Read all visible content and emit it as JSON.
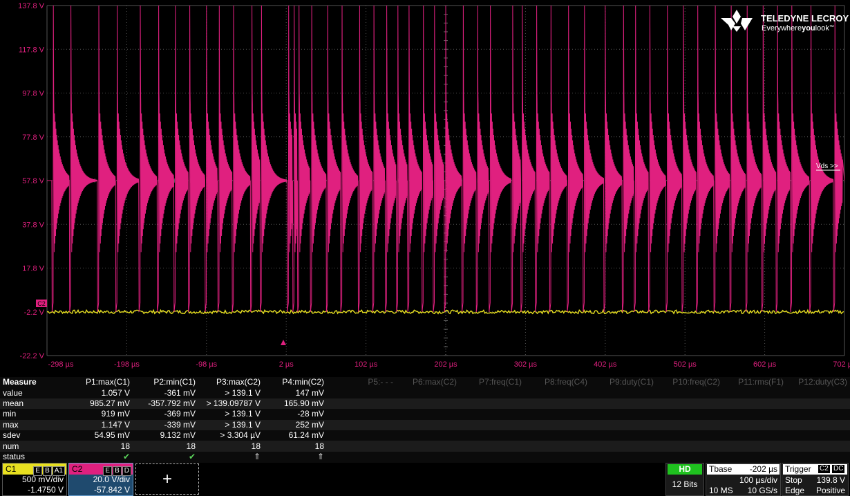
{
  "brand": {
    "name": "TELEDYNE LECROY",
    "tagline_parts": [
      "Everywhere",
      "you",
      "look"
    ],
    "trademark": "™"
  },
  "colors": {
    "c1": "#e8e020",
    "c2": "#e0207f",
    "grid": "#555555",
    "measure_ok": "#5cd65c"
  },
  "y_axis_labels": [
    "137.8 V",
    "117.8 V",
    "97.8 V",
    "77.8 V",
    "57.8 V",
    "37.8 V",
    "17.8 V",
    "-2.2 V",
    "-22.2 V"
  ],
  "x_axis_labels": [
    "-298 µs",
    "-198 µs",
    "-98 µs",
    "2 µs",
    "102 µs",
    "202 µs",
    "302 µs",
    "402 µs",
    "502 µs",
    "602 µs",
    "702 µs"
  ],
  "trace_label": "Vds >>",
  "channel_marker": "C2",
  "measure": {
    "title": "Measure",
    "params": [
      {
        "label": "P1:max(C1)",
        "active": true
      },
      {
        "label": "P2:min(C1)",
        "active": true
      },
      {
        "label": "P3:max(C2)",
        "active": true
      },
      {
        "label": "P4:min(C2)",
        "active": true
      },
      {
        "label": "P5:- - -",
        "active": false
      },
      {
        "label": "P6:max(C2)",
        "active": false
      },
      {
        "label": "P7:freq(C1)",
        "active": false
      },
      {
        "label": "P8:freq(C4)",
        "active": false
      },
      {
        "label": "P9:duty(C1)",
        "active": false
      },
      {
        "label": "P10:freq(C2)",
        "active": false
      },
      {
        "label": "P11:rms(F1)",
        "active": false
      },
      {
        "label": "P12:duty(C3)",
        "active": false
      }
    ],
    "rows": [
      {
        "label": "value",
        "cells": [
          "1.057 V",
          "-361 mV",
          "> 139.1 V",
          "147 mV"
        ]
      },
      {
        "label": "mean",
        "cells": [
          "985.27 mV",
          "-357.792 mV",
          "> 139.09787 V",
          "165.90 mV"
        ]
      },
      {
        "label": "min",
        "cells": [
          "919 mV",
          "-369 mV",
          "> 139.1 V",
          "-28 mV"
        ]
      },
      {
        "label": "max",
        "cells": [
          "1.147 V",
          "-339 mV",
          "> 139.1 V",
          "252 mV"
        ]
      },
      {
        "label": "sdev",
        "cells": [
          "54.95 mV",
          "9.132 mV",
          "> 3.304 µV",
          "61.24 mV"
        ]
      },
      {
        "label": "num",
        "cells": [
          "18",
          "18",
          "18",
          "18"
        ]
      },
      {
        "label": "status",
        "cells": [
          "✔",
          "✔",
          "⇑",
          "⇑"
        ]
      }
    ]
  },
  "channels": {
    "c1": {
      "name": "C1",
      "tags": [
        "E",
        "B",
        "A1"
      ],
      "scale": "500 mV/div",
      "offset": "-1.4750 V"
    },
    "c2": {
      "name": "C2",
      "tags": [
        "E",
        "B",
        "D"
      ],
      "scale": "20.0 V/div",
      "offset": "-57.842 V"
    },
    "add": "+"
  },
  "acquisition": {
    "hd": "HD",
    "bits": "12 Bits"
  },
  "timebase": {
    "label": "Tbase",
    "delay": "-202 µs",
    "per_div": "100 µs/div",
    "samples": "10 MS",
    "rate": "10 GS/s"
  },
  "trigger": {
    "label": "Trigger",
    "source": "C2",
    "coupling": "DC",
    "mode": "Stop",
    "level": "139.8 V",
    "type": "Edge",
    "slope": "Positive"
  }
}
